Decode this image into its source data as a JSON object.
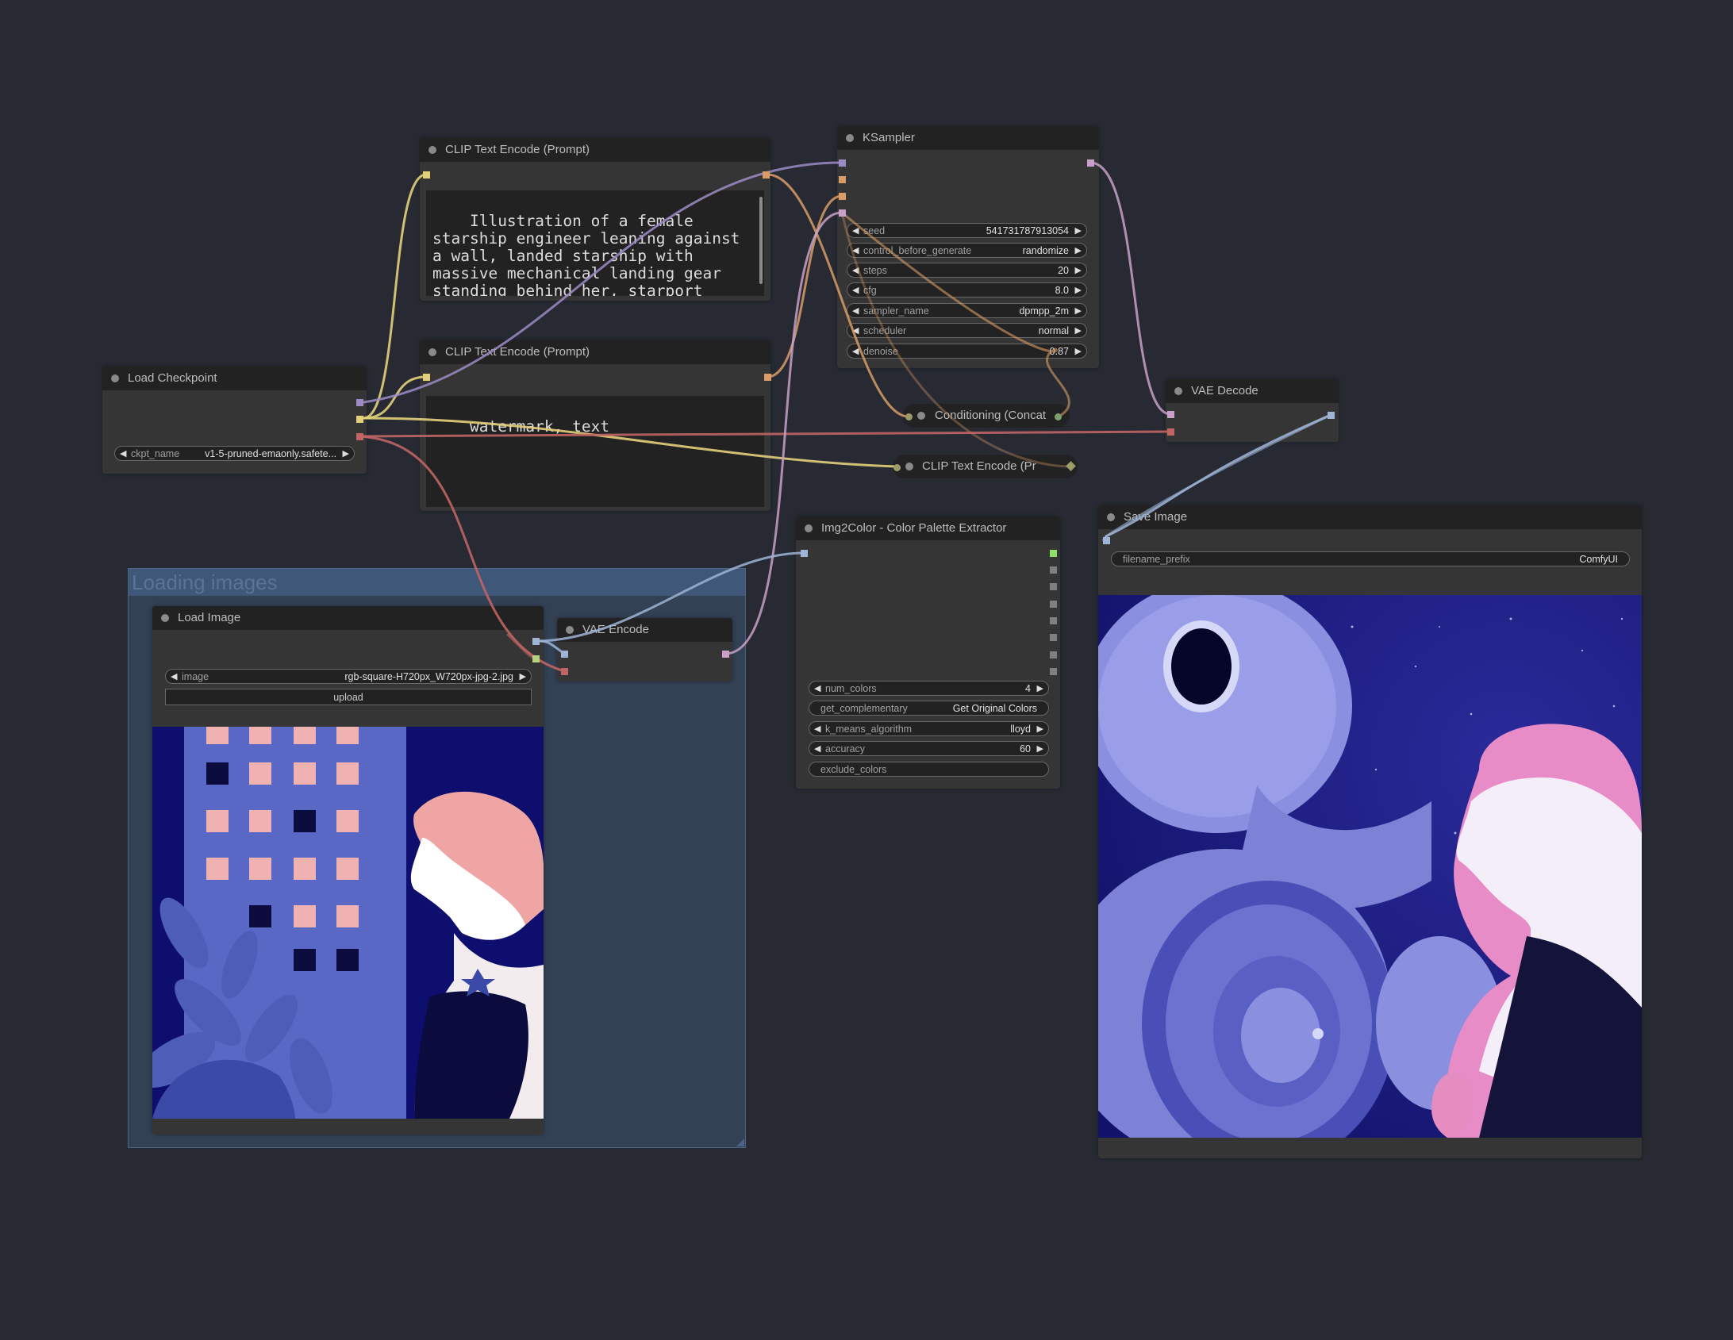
{
  "group": {
    "title": "Loading images"
  },
  "nodes": {
    "clip_positive": {
      "title": "CLIP Text Encode (Prompt)",
      "text": "Illustration of a female starship engineer leaning against a wall, landed starship with massive mechanical landing gear standing behind her, starport docking bay"
    },
    "clip_negative": {
      "title": "CLIP Text Encode (Prompt)",
      "text": "watermark, text"
    },
    "load_checkpoint": {
      "title": "Load Checkpoint",
      "ckpt_name": {
        "label": "ckpt_name",
        "value": "v1-5-pruned-emaonly.safete..."
      }
    },
    "ksampler": {
      "title": "KSampler",
      "widgets": [
        {
          "label": "seed",
          "value": "541731787913054"
        },
        {
          "label": "control_before_generate",
          "value": "randomize"
        },
        {
          "label": "steps",
          "value": "20"
        },
        {
          "label": "cfg",
          "value": "8.0"
        },
        {
          "label": "sampler_name",
          "value": "dpmpp_2m"
        },
        {
          "label": "scheduler",
          "value": "normal"
        },
        {
          "label": "denoise",
          "value": "0.87"
        }
      ]
    },
    "conditioning_concat": {
      "title": "Conditioning (Concat"
    },
    "clip_collapsed": {
      "title": "CLIP Text Encode (Pr"
    },
    "vae_decode": {
      "title": "VAE Decode"
    },
    "save_image": {
      "title": "Save Image",
      "filename_prefix": {
        "label": "filename_prefix",
        "value": "ComfyUI"
      }
    },
    "img2color": {
      "title": "Img2Color - Color Palette Extractor",
      "widgets": [
        {
          "label": "num_colors",
          "value": "4",
          "arrows": true
        },
        {
          "label": "get_complementary",
          "value": "Get Original Colors",
          "arrows": false
        },
        {
          "label": "k_means_algorithm",
          "value": "lloyd",
          "arrows": true
        },
        {
          "label": "accuracy",
          "value": "60",
          "arrows": true
        },
        {
          "label": "exclude_colors",
          "value": "",
          "arrows": false
        }
      ]
    },
    "load_image": {
      "title": "Load Image",
      "image": {
        "label": "image",
        "value": "rgb-square-H720px_W720px-jpg-2.jpg"
      },
      "upload_label": "upload"
    },
    "vae_encode": {
      "title": "VAE Encode"
    }
  },
  "colors": {
    "canvas": "#272a33",
    "clip_wire": "#ffd500",
    "model_wire": "#b39ddb",
    "conditioning_wire": "#ffa931",
    "vae_wire": "#ff6e6e",
    "latent_wire": "#ff9cf9",
    "image_wire": "#64b5f6"
  }
}
